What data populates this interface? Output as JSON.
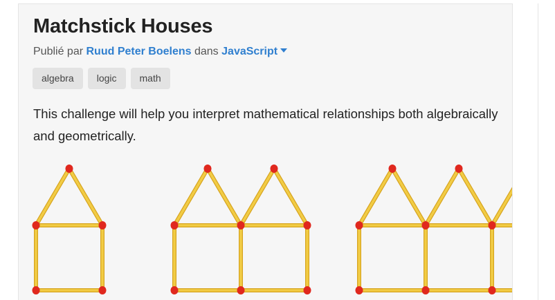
{
  "article": {
    "title": "Matchstick Houses",
    "published_prefix": "Publié par",
    "author": "Ruud Peter Boelens",
    "in_word": "dans",
    "language": "JavaScript",
    "tags": [
      "algebra",
      "logic",
      "math"
    ],
    "description": "This challenge will help you interpret mathematical relationships both algebraically and geometrically."
  },
  "illustration": {
    "groups": [
      1,
      2,
      3
    ],
    "stick_color": "#f2cc45",
    "stick_edge_color": "#d6a31e",
    "head_color": "#e0281e"
  },
  "colors": {
    "link": "#2f7fcf",
    "title_text": "#222222",
    "tag_bg": "#e3e3e3",
    "card_bg": "#f6f6f6"
  }
}
